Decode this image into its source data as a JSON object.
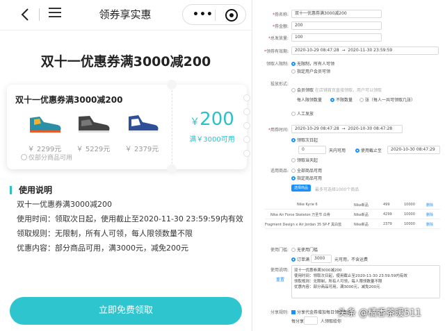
{
  "phone": {
    "nav_title": "领券享实惠",
    "page_title": "双十一优惠券满3000减200",
    "coupon": {
      "name": "双十一优惠券满3000减200",
      "products": [
        {
          "price": "￥ 2299元",
          "color": "#2b8fa8"
        },
        {
          "price": "￥ 5229元",
          "color": "#444444"
        },
        {
          "price": "￥ 2379元",
          "color": "#2f4f9a"
        }
      ],
      "note": "仅部分商品可用",
      "amount_symbol": "￥",
      "amount_value": "200",
      "amount_condition": "满￥3000可用"
    },
    "usage": {
      "title": "使用说明",
      "lines": [
        "双十一优惠券满3000减200",
        "使用时间：领取次日起，使用截止至2020-11-30 23:59:59内有效",
        "领取规则：无限制，所有人可领，每人限领数量不限",
        "优惠内容：部分商品可用，满3000元，减免200元"
      ]
    },
    "cta": "立即免费领取"
  },
  "admin": {
    "name_label": "券名称",
    "name_value": "双十一优惠券满3000减200",
    "amount_label": "券金额",
    "amount_value": "200",
    "total_label": "总发放量",
    "total_value": "100",
    "claim_time_label": "领券有效期",
    "claim_start": "2020-10-29 08:47:28",
    "claim_end": "2020-11-30 23:59:59",
    "claim_limit_label": "领取人限制",
    "claim_opts": [
      "无限制，所有人可领",
      "指定用户会员可领"
    ],
    "method_label": "投放形式",
    "method_opt1": "会员领取",
    "method_opt1_desc": "在店铺首页直接领取，用户可以领取",
    "method_per_label": "每人限领数量",
    "method_per_opts": [
      "不限数量",
      "张（每人一共可领取几张）"
    ],
    "method_opt2": "人工发放",
    "use_time_label": "用券时间",
    "use_start": "2020-10-29 08:47:28",
    "use_end": "2020-10-30 08:47:28",
    "use_opts": [
      "领取次日起",
      "天内可用",
      "使用截止至",
      "领取当天起"
    ],
    "use_days": "0",
    "use_deadline": "2020-10-30 08:47:29",
    "goods_label": "适用商品",
    "goods_opts": [
      "全部商品可用",
      "指定商品可用"
    ],
    "goods_button": "选择商品",
    "goods_hint": "最多可选择1000个商品",
    "goods_rows": [
      {
        "name": "Nike Kyrie 6",
        "brand": "Nike新品",
        "price": "499",
        "stock": "10000",
        "op": "删除"
      },
      {
        "name": "Nike Air Force Skeleton 万圣节 白骨",
        "brand": "Nike新品",
        "price": "4299",
        "stock": "10000",
        "op": "删除"
      },
      {
        "name": "Fragment Design x Air Jordan 35 SP-F 黑白蓝",
        "brand": "Nike新品",
        "price": "2379",
        "stock": "10000",
        "op": "删除"
      }
    ],
    "threshold_label": "使用门槛",
    "threshold_opts": [
      "无使用门槛",
      "订单满",
      "元可用，不含运费"
    ],
    "threshold_value": "3000",
    "desc_label": "使用说明",
    "desc_reset": "重置",
    "desc_lines": [
      "双十一优惠券满3000减200",
      "使用时间：领取次日起，使用截止至2020-11-30 23:59:59内有效",
      "领取规则：无限制，所有人可领，每人限领数量不限",
      "优惠内容：部分商品可用，满3000元，减免200元"
    ],
    "share_label": "分享规则",
    "share_opt": "分享代金券增加每日领取数量",
    "share_line1": "每分享",
    "share_line2": "人领取给你",
    "watermark": "头条 @橘香茶暖511"
  }
}
